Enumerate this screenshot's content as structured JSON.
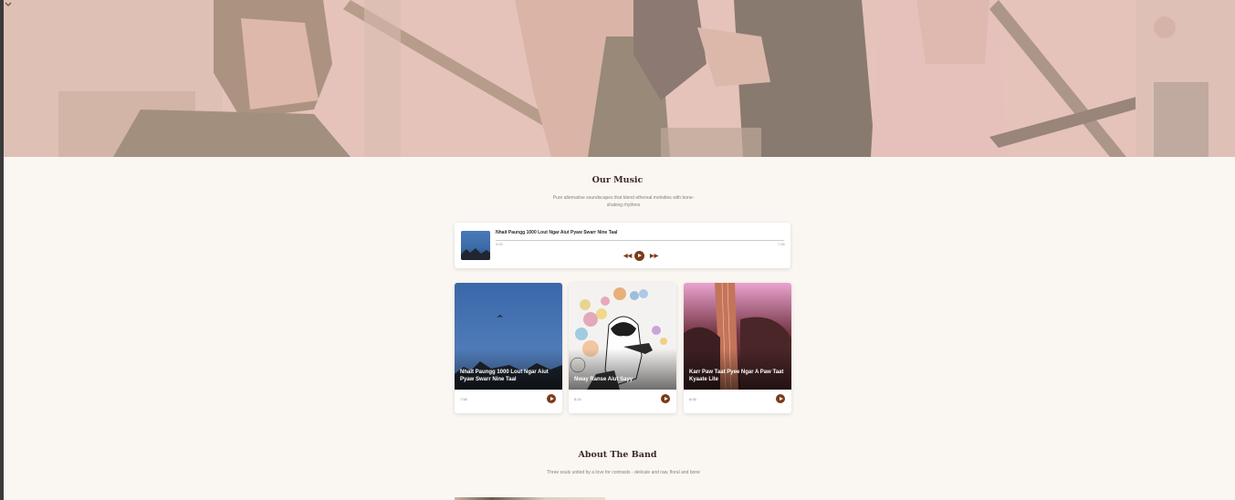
{
  "hero": {
    "scroll_icon": "chevron-down-icon"
  },
  "music": {
    "title": "Our Music",
    "subtitle": "Pure alternative soundscapes that blend ethereal melodies with bone-shaking rhythms"
  },
  "player": {
    "track_title": "Nhait Paungg 1000 Lout Ngar Aiut Pyaw Swarr Nine Taal",
    "current_time": "0:00",
    "total_time": "7:56",
    "progress": 0,
    "prev_icon": "rewind-icon",
    "play_icon": "play-icon",
    "next_icon": "fast-forward-icon"
  },
  "tracks": [
    {
      "title": "Nhait Paungg 1000 Lout Ngar Aiut Pyaw Swarr Nine Taal",
      "duration": "7:56"
    },
    {
      "title": "Nway Ranse Aiut Sayy",
      "duration": "5:24"
    },
    {
      "title": "Karr Paw Taat Pyee Ngar A Paw Taat Kyaate Lite",
      "duration": "6:05"
    }
  ],
  "about": {
    "title": "About The Band",
    "subtitle": "Three souls united by a love for contrasts - delicate and raw, floral and bone"
  },
  "colors": {
    "accent": "#7a3c17",
    "background": "#faf6f2",
    "hero_tint": "#e8c6c2"
  }
}
